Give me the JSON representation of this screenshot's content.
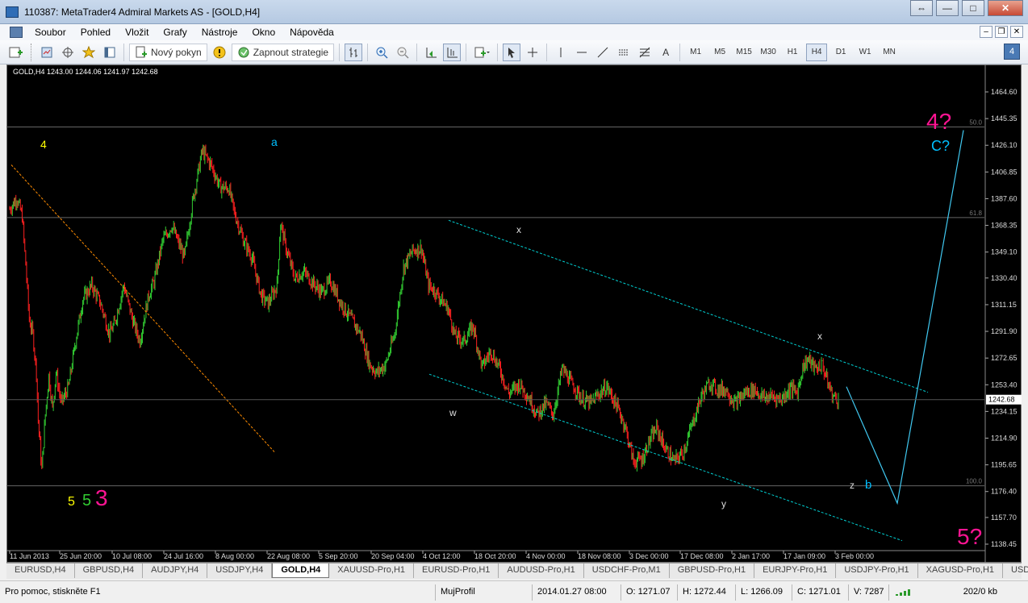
{
  "window": {
    "title": "110387: MetaTrader4 Admiral Markets AS - [GOLD,H4]",
    "buttons": [
      "⇔",
      "—",
      "□",
      "✕"
    ]
  },
  "menu": [
    "Soubor",
    "Pohled",
    "Vložit",
    "Grafy",
    "Nástroje",
    "Okno",
    "Nápověda"
  ],
  "toolbar": {
    "new_order": "Nový pokyn",
    "autotrading": "Zapnout strategie",
    "timeframes": [
      "M1",
      "M5",
      "M15",
      "M30",
      "H1",
      "H4",
      "D1",
      "W1",
      "MN"
    ],
    "active_timeframe": "H4",
    "text_tool": "A"
  },
  "chart": {
    "header": "GOLD,H4  1243.00 1244.06 1241.97 1242.68",
    "current_price": "1242.68",
    "price_axis": [
      "1464.60",
      "1445.35",
      "1426.10",
      "1406.85",
      "1387.60",
      "1368.35",
      "1349.10",
      "1330.40",
      "1311.15",
      "1291.90",
      "1272.65",
      "1253.40",
      "1234.15",
      "1214.90",
      "1195.65",
      "1176.40",
      "1157.70",
      "1138.45"
    ],
    "time_axis": [
      "11 Jun 2013",
      "25 Jun 20:00",
      "10 Jul 08:00",
      "24 Jul 16:00",
      "8 Aug 00:00",
      "22 Aug 08:00",
      "5 Sep 20:00",
      "20 Sep 04:00",
      "4 Oct 12:00",
      "18 Oct 20:00",
      "4 Nov 00:00",
      "18 Nov 08:00",
      "3 Dec 00:00",
      "17 Dec 08:00",
      "2 Jan 17:00",
      "17 Jan 09:00",
      "3 Feb 00:00"
    ],
    "fib_levels": [
      {
        "label": "50.0",
        "price": 1439.3
      },
      {
        "label": "61.8",
        "price": 1374.0
      },
      {
        "label": "100.0",
        "price": 1180.5
      }
    ],
    "wave_labels": [
      {
        "text": "4",
        "color": "#ffff00"
      },
      {
        "text": "a",
        "color": "#00bfff"
      },
      {
        "text": "x",
        "color": "#dddddd"
      },
      {
        "text": "w",
        "color": "#dddddd"
      },
      {
        "text": "x",
        "color": "#dddddd"
      },
      {
        "text": "y",
        "color": "#dddddd"
      },
      {
        "text": "z",
        "color": "#dddddd"
      },
      {
        "text": "b",
        "color": "#00bfff"
      },
      {
        "text": "5",
        "color": "#ffff00"
      },
      {
        "text": "5",
        "color": "#32cd32"
      },
      {
        "text": "3",
        "color": "#ff1493"
      },
      {
        "text": "4?",
        "color": "#ff1493"
      },
      {
        "text": "C?",
        "color": "#00bfff"
      },
      {
        "text": "5?",
        "color": "#ff1493"
      }
    ],
    "colors": {
      "bull": "#32cd32",
      "bear": "#ff2020",
      "channel": "#00ced1",
      "projection": "#40c8f0",
      "trendline": "#ff8c00",
      "fib": "#666666"
    }
  },
  "tabs": [
    "EURUSD,H4",
    "GBPUSD,H4",
    "AUDJPY,H4",
    "USDJPY,H4",
    "GOLD,H4",
    "XAUUSD-Pro,H1",
    "EURUSD-Pro,H1",
    "AUDUSD-Pro,H1",
    "USDCHF-Pro,M1",
    "GBPUSD-Pro,H1",
    "EURJPY-Pro,H1",
    "USDJPY-Pro,H1",
    "XAGUSD-Pro,H1",
    "USDCAI"
  ],
  "active_tab": "GOLD,H4",
  "status": {
    "help": "Pro pomoc, stiskněte F1",
    "profile": "MujProfil",
    "datetime": "2014.01.27 08:00",
    "open": "O: 1271.07",
    "high": "H: 1272.44",
    "low": "L: 1266.09",
    "close": "C: 1271.01",
    "volume": "V: 7287",
    "traffic": "202/0 kb"
  }
}
